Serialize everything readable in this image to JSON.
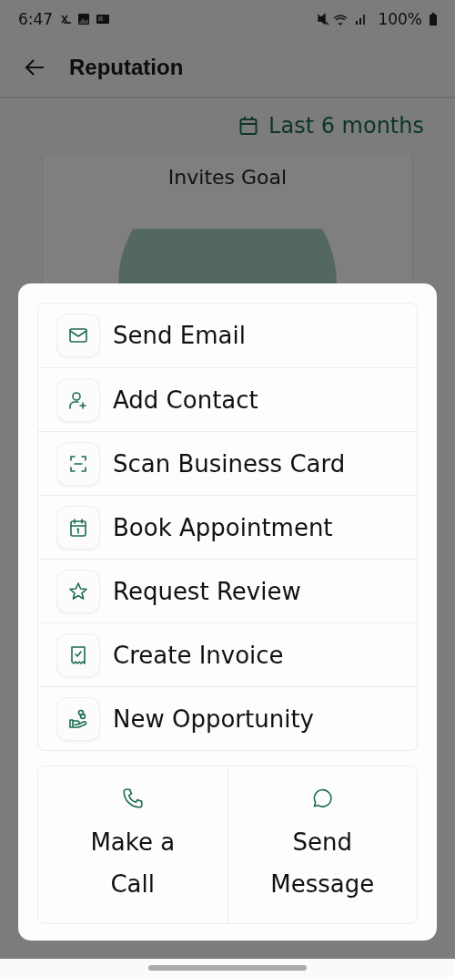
{
  "status_bar": {
    "time": "6:47",
    "battery": "100%"
  },
  "app_bar": {
    "title": "Reputation"
  },
  "date_filter": {
    "label": "Last 6 months"
  },
  "goal_card": {
    "title": "Invites Goal"
  },
  "action_sheet": {
    "items": [
      {
        "label": "Send Email"
      },
      {
        "label": "Add Contact"
      },
      {
        "label": "Scan Business Card"
      },
      {
        "label": "Book Appointment"
      },
      {
        "label": "Request Review"
      },
      {
        "label": "Create Invoice"
      },
      {
        "label": "New Opportunity"
      }
    ],
    "buttons": [
      {
        "label": "Make a Call"
      },
      {
        "label": "Send Message"
      }
    ]
  }
}
